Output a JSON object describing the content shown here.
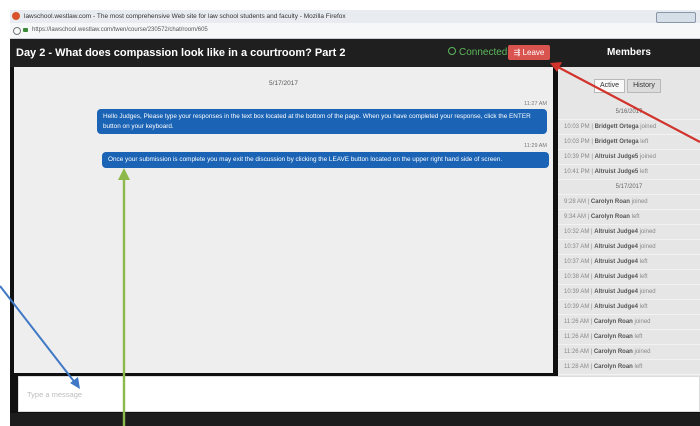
{
  "browser": {
    "title": "lawschool.westlaw.com - The most comprehensive Web site for law school students and faculty - Mozilla Firefox",
    "url": "https://lawschool.westlaw.com/twen/course/230572/chat/room/605"
  },
  "header": {
    "room_title": "Day 2 - What does compassion look like in a courtroom? Part 2",
    "status": "Connected",
    "leave_label": "Leave",
    "members_title": "Members"
  },
  "chat": {
    "date": "5/17/2017",
    "messages": [
      {
        "time": "11:27 AM",
        "text": "Hello Judges, Please type your responses in the text box located at the bottom of the page. When you have completed your response, click the ENTER button on your keyboard."
      },
      {
        "time": "11:29 AM",
        "text": "Once your submission is complete you may exit the discussion by clicking the LEAVE button located on the upper right hand side of screen."
      }
    ]
  },
  "members": {
    "tabs": [
      {
        "label": "Active"
      },
      {
        "label": "History"
      }
    ],
    "history": [
      {
        "type": "date",
        "text": "5/16/2017"
      },
      {
        "time": "10:03 PM",
        "name": "Bridgett Ortega",
        "action": "joined"
      },
      {
        "time": "10:03 PM",
        "name": "Bridgett Ortega",
        "action": "left"
      },
      {
        "time": "10:39 PM",
        "name": "Altruist Judge5",
        "action": "joined"
      },
      {
        "time": "10:41 PM",
        "name": "Altruist Judge5",
        "action": "left"
      },
      {
        "type": "date",
        "text": "5/17/2017"
      },
      {
        "time": "9:28 AM",
        "name": "Carolyn Roan",
        "action": "joined"
      },
      {
        "time": "9:34 AM",
        "name": "Carolyn Roan",
        "action": "left"
      },
      {
        "time": "10:32 AM",
        "name": "Altruist Judge4",
        "action": "joined"
      },
      {
        "time": "10:37 AM",
        "name": "Altruist Judge4",
        "action": "joined"
      },
      {
        "time": "10:37 AM",
        "name": "Altruist Judge4",
        "action": "left"
      },
      {
        "time": "10:38 AM",
        "name": "Altruist Judge4",
        "action": "left"
      },
      {
        "time": "10:39 AM",
        "name": "Altruist Judge4",
        "action": "joined"
      },
      {
        "time": "10:39 AM",
        "name": "Altruist Judge4",
        "action": "left"
      },
      {
        "time": "11:26 AM",
        "name": "Carolyn Roan",
        "action": "joined"
      },
      {
        "time": "11:26 AM",
        "name": "Carolyn Roan",
        "action": "left"
      },
      {
        "time": "11:26 AM",
        "name": "Carolyn Roan",
        "action": "joined"
      },
      {
        "time": "11:28 AM",
        "name": "Carolyn Roan",
        "action": "left"
      }
    ]
  },
  "composer": {
    "placeholder": "Type a message"
  },
  "colors": {
    "accent": "#1a63b5",
    "leave": "#d9534f",
    "connected": "#5cb85c",
    "arrow_red": "#d0342c",
    "arrow_blue": "#3f78c4",
    "arrow_green": "#8db84a"
  }
}
